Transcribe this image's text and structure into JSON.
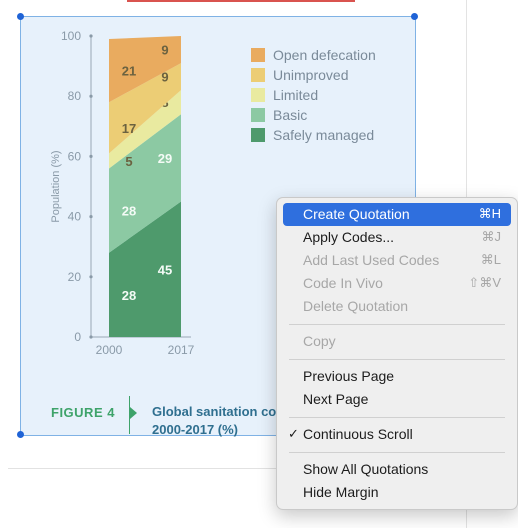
{
  "chart_data": {
    "type": "bar",
    "stacked": true,
    "categories": [
      "2000",
      "2017"
    ],
    "series": [
      {
        "name": "Safely managed",
        "values": [
          28,
          45
        ],
        "color": "#4e9a6c"
      },
      {
        "name": "Basic",
        "values": [
          28,
          29
        ],
        "color": "#8cc9a3"
      },
      {
        "name": "Limited",
        "values": [
          5,
          8
        ],
        "color": "#e9eaa0"
      },
      {
        "name": "Unimproved",
        "values": [
          17,
          9
        ],
        "color": "#eccd75"
      },
      {
        "name": "Open defecation",
        "values": [
          21,
          9
        ],
        "color": "#e9ab5f"
      }
    ],
    "ylabel": "Population (%)",
    "yticks": [
      0,
      20,
      40,
      60,
      80,
      100
    ],
    "ylim": [
      0,
      100
    ],
    "legend": [
      "Open defecation",
      "Unimproved",
      "Limited",
      "Basic",
      "Safely managed"
    ],
    "legend_placement": "top-right",
    "colors": {
      "Open defecation": "#e9ab5f",
      "Unimproved": "#eccd75",
      "Limited": "#e9eaa0",
      "Basic": "#8cc9a3",
      "Safely managed": "#4e9a6c"
    }
  },
  "figure": {
    "label": "FIGURE 4",
    "caption": "Global sanitation cove\n2000-2017 (%)"
  },
  "context_menu": {
    "items": [
      {
        "label": "Create Quotation",
        "shortcut": "⌘H",
        "highlighted": true
      },
      {
        "label": "Apply Codes...",
        "shortcut": "⌘J"
      },
      {
        "label": "Add Last Used Codes",
        "shortcut": "⌘L",
        "disabled": true
      },
      {
        "label": "Code In Vivo",
        "shortcut": "⇧⌘V",
        "disabled": true
      },
      {
        "label": "Delete Quotation",
        "disabled": true
      },
      {
        "label": "Copy",
        "disabled": true
      },
      {
        "label": "Previous Page"
      },
      {
        "label": "Next Page"
      },
      {
        "label": "Continuous Scroll",
        "check": "✓"
      },
      {
        "label": "Show All Quotations"
      },
      {
        "label": "Hide Margin"
      }
    ]
  },
  "colors": {
    "accent": "#2f6fde",
    "figure_label": "#3ea36a",
    "caption": "#2f6f8f",
    "selection_border": "#7fb2e5",
    "selection_handle": "#1f63d6"
  }
}
